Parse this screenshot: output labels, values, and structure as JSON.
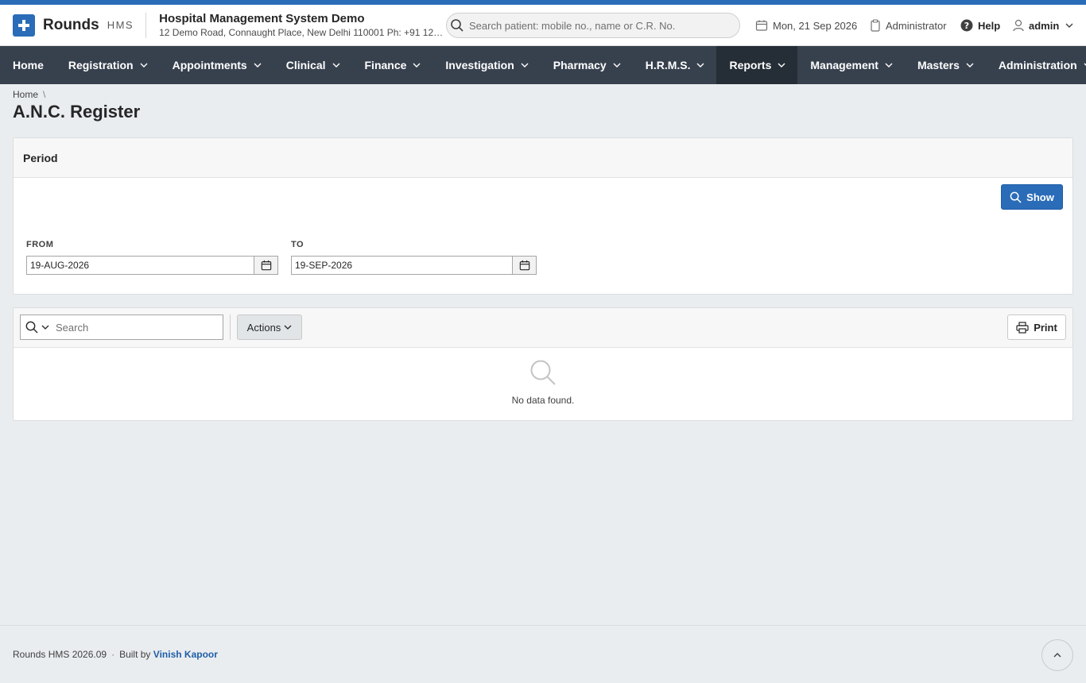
{
  "app": {
    "brand": "Rounds",
    "brand_sub": "HMS",
    "org_name": "Hospital Management System Demo",
    "org_address": "12 Demo Road, Connaught Place, New Delhi 110001 Ph: +91 123..."
  },
  "header": {
    "search_placeholder": "Search patient: mobile no., name or C.R. No.",
    "date": "Mon, 21 Sep 2026",
    "role": "Administrator",
    "help": "Help",
    "user": "admin"
  },
  "nav": [
    {
      "label": "Home",
      "has_menu": false,
      "active": false
    },
    {
      "label": "Registration",
      "has_menu": true,
      "active": false
    },
    {
      "label": "Appointments",
      "has_menu": true,
      "active": false
    },
    {
      "label": "Clinical",
      "has_menu": true,
      "active": false
    },
    {
      "label": "Finance",
      "has_menu": true,
      "active": false
    },
    {
      "label": "Investigation",
      "has_menu": true,
      "active": false
    },
    {
      "label": "Pharmacy",
      "has_menu": true,
      "active": false
    },
    {
      "label": "H.R.M.S.",
      "has_menu": true,
      "active": false
    },
    {
      "label": "Reports",
      "has_menu": true,
      "active": true
    },
    {
      "label": "Management",
      "has_menu": true,
      "active": false
    },
    {
      "label": "Masters",
      "has_menu": true,
      "active": false
    },
    {
      "label": "Administration",
      "has_menu": true,
      "active": false
    }
  ],
  "breadcrumb": {
    "home": "Home",
    "separator": "\\"
  },
  "page": {
    "title": "A.N.C. Register"
  },
  "period": {
    "heading": "Period",
    "show_label": "Show",
    "from_label": "FROM",
    "from_value": "19-AUG-2026",
    "to_label": "TO",
    "to_value": "19-SEP-2026"
  },
  "report": {
    "search_placeholder": "Search",
    "actions_label": "Actions",
    "print_label": "Print",
    "empty_message": "No data found."
  },
  "footer": {
    "product": "Rounds HMS 2026.09",
    "separator": "·",
    "built_by": "Built by",
    "author": "Vinish Kapoor"
  },
  "colors": {
    "accent": "#2a6cb8",
    "nav_bg": "#37414e",
    "nav_active": "#252d36",
    "page_bg": "#eaedf0"
  }
}
